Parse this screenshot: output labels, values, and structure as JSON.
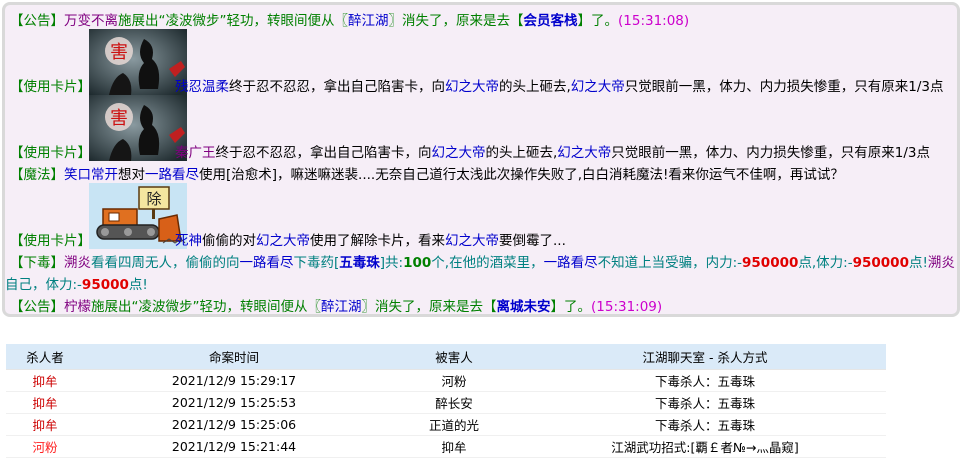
{
  "chat": {
    "lines": [
      {
        "tag": "【公告】",
        "actor": "万变不离",
        "t1": "施展出“凌波微步”轻功，转眼间便从〖",
        "place": "醉江湖",
        "t2": "〗消失了，原来是去【",
        "dest": "会员客栈",
        "t3": "】了。",
        "time": "(15:31:08)"
      },
      {
        "tag": "【使用卡片】",
        "actor": "残忍温柔",
        "t1": "终于忍不忍忍，拿出自己陷害卡，向",
        "target": "幻之大帝",
        "t2": "的头上砸去,",
        "target2": "幻之大帝",
        "t3": "只觉眼前一黑，体力、内力损失惨重，只有原来1/3点"
      },
      {
        "tag": "【使用卡片】",
        "actor": "秦广王",
        "t1": "终于忍不忍忍，拿出自己陷害卡，向",
        "target": "幻之大帝",
        "t2": "的头上砸去,",
        "target2": "幻之大帝",
        "t3": "只觉眼前一黑，体力、内力损失惨重，只有原来1/3点"
      },
      {
        "tag": "【魔法】",
        "actor": "笑口常开",
        "t1": "想对",
        "target": "一路看尽",
        "t2": "使用[治愈术]，嘛迷嘛迷裴....无奈自己道行太浅此次操作失败了,白白消耗魔法!看来你运气不佳啊，再试试？"
      },
      {
        "tag": "【使用卡片】",
        "actor": "死神",
        "t1": "偷偷的对",
        "target": "幻之大帝",
        "t2": "使用了解除卡片，看来",
        "target2": "幻之大帝",
        "t3": "要倒霉了..."
      },
      {
        "tag": "【下毒】",
        "actor": "溯炎",
        "t1": "看看四周无人，偷偷的向",
        "target": "一路看尽",
        "t2": "下毒药[",
        "item": "五毒珠",
        "t3": "]共:",
        "count": "100",
        "t4": "个,在他的酒菜里，",
        "target2": "一路看尽",
        "t5": "不知道上当受骗，内力:-",
        "mp": "950000",
        "t6": "点,体力:-",
        "hp": "950000",
        "t7": "点!",
        "actor2": "溯炎",
        "t8": "自己，体力:-",
        "hp2": "95000",
        "t9": "点!"
      },
      {
        "tag": "【公告】",
        "actor": "柠檬",
        "t1": "施展出“凌波微步”轻功，转眼间便从〖",
        "place": "醉江湖",
        "t2": "〗消失了，原来是去【",
        "dest": "离城未安",
        "t3": "】了。",
        "time": "(15:31:09)"
      }
    ],
    "card_image_text": "害",
    "remove_card_text": "除"
  },
  "table": {
    "headers": [
      "杀人者",
      "命案时间",
      "被害人",
      "江湖聊天室 - 杀人方式"
    ],
    "rows": [
      {
        "killer": "抑牟",
        "time": "2021/12/9 15:29:17",
        "victim": "河粉",
        "method": "下毒杀人：五毒珠"
      },
      {
        "killer": "抑牟",
        "time": "2021/12/9 15:25:53",
        "victim": "醉长安",
        "method": "下毒杀人：五毒珠"
      },
      {
        "killer": "抑牟",
        "time": "2021/12/9 15:25:06",
        "victim": "正道的光",
        "method": "下毒杀人：五毒珠"
      },
      {
        "killer": "河粉",
        "time": "2021/12/9 15:21:44",
        "victim": "抑牟",
        "method": "江湖武功招式:[覇￡者№→灬晶窥]"
      }
    ]
  }
}
